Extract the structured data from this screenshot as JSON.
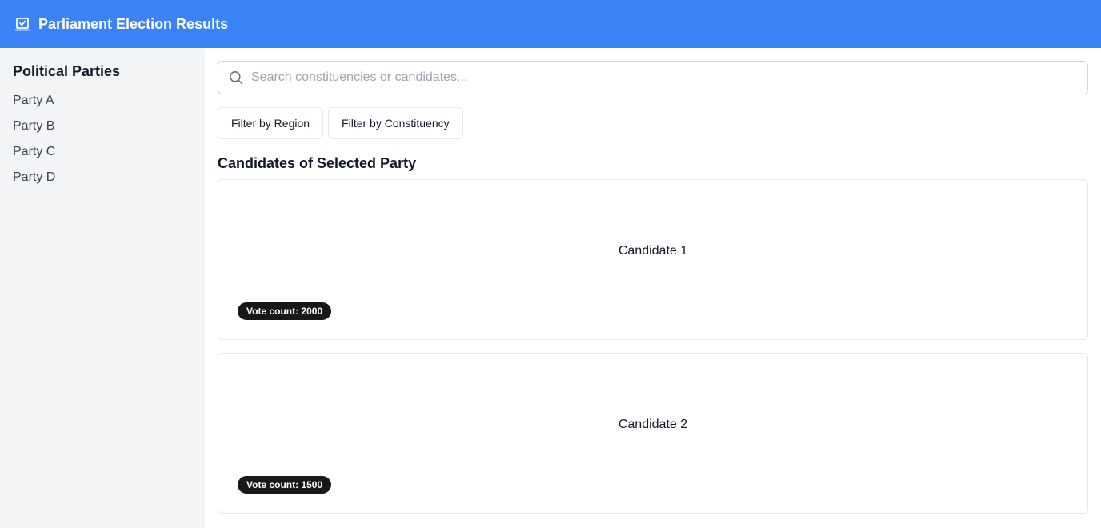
{
  "header": {
    "icon": "ballot-check-icon",
    "title": "Parliament Election Results",
    "color": "#3b82f6"
  },
  "sidebar": {
    "title": "Political Parties",
    "parties": [
      "Party A",
      "Party B",
      "Party C",
      "Party D"
    ]
  },
  "search": {
    "icon": "search-icon",
    "placeholder": "Search constituencies or candidates...",
    "value": ""
  },
  "filters": {
    "region_label": "Filter by Region",
    "constituency_label": "Filter by Constituency"
  },
  "section": {
    "title": "Candidates of Selected Party"
  },
  "candidates": [
    {
      "name": "Candidate 1",
      "votes": "Vote count: 2000"
    },
    {
      "name": "Candidate 2",
      "votes": "Vote count: 1500"
    }
  ]
}
